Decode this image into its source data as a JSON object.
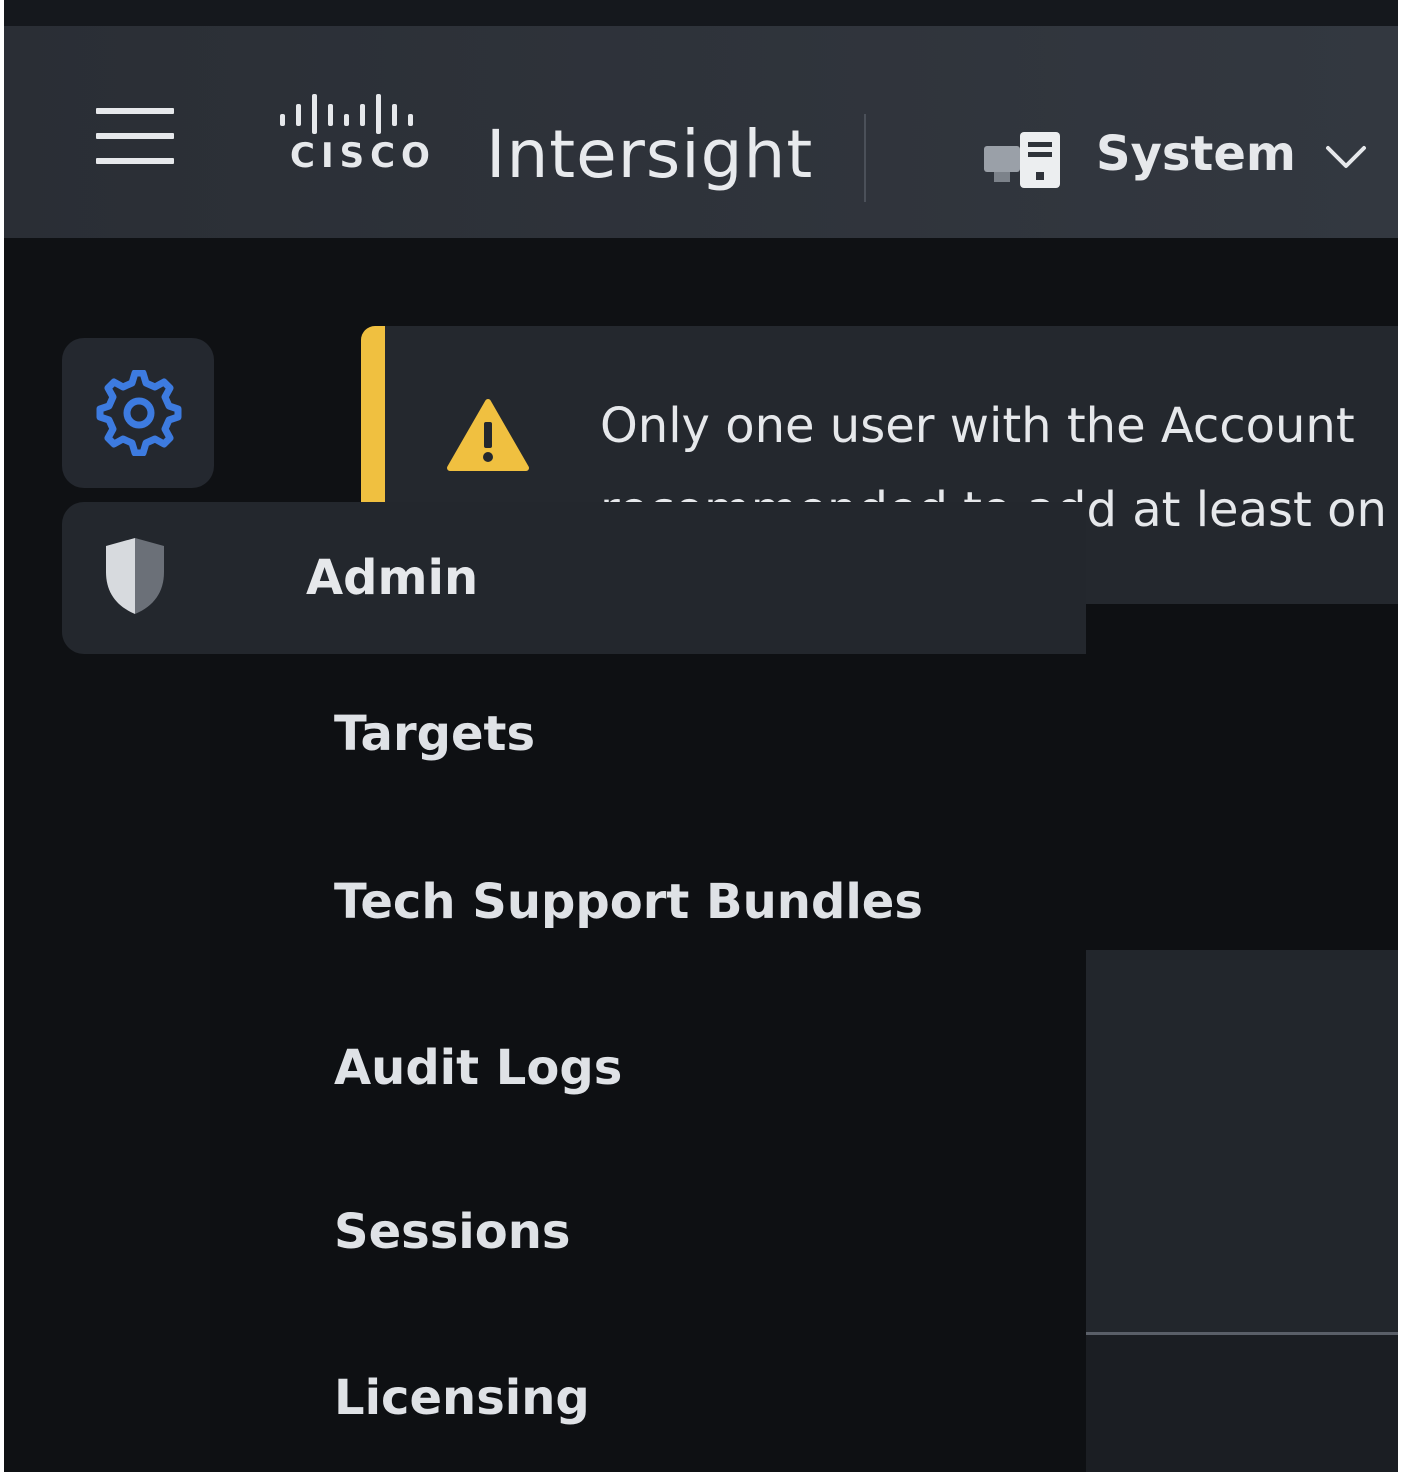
{
  "header": {
    "brand_word": "CISCO",
    "app_title": "Intersight",
    "scope_selector": {
      "label": "System",
      "icon": "system-icon"
    }
  },
  "banner": {
    "type": "warning",
    "icon": "warning-icon",
    "line1": "Only one user with the Account",
    "line2": "recommended to add at least on"
  },
  "sidebar": {
    "settings_icon": "gear-icon",
    "active_item": {
      "label": "Admin",
      "icon": "shield-icon"
    },
    "submenu": [
      {
        "label": "Targets"
      },
      {
        "label": "Tech Support Bundles"
      },
      {
        "label": "Audit Logs"
      },
      {
        "label": "Sessions"
      },
      {
        "label": "Licensing"
      }
    ]
  },
  "colors": {
    "header_bg": "#2f333a",
    "page_bg": "#0f1114",
    "panel_bg": "#24282e",
    "warning_accent": "#f0c040",
    "gear_accent": "#3d7be0",
    "text": "#e6e8eb"
  }
}
